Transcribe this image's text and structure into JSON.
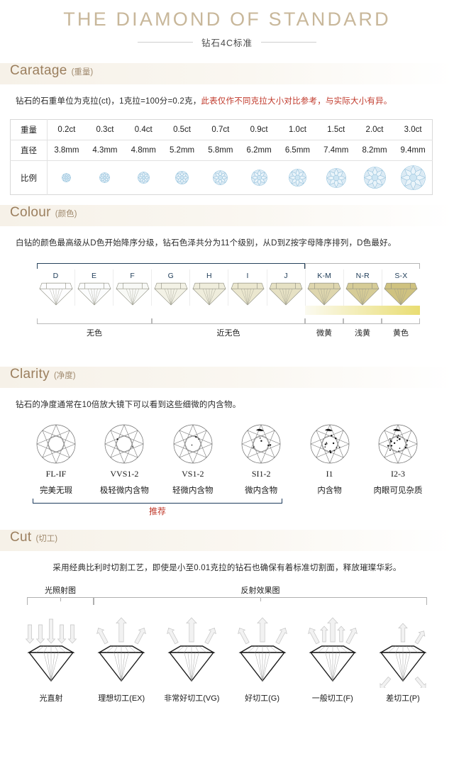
{
  "masthead": {
    "title": "THE DIAMOND OF STANDARD",
    "subtitle": "钻石4C标准"
  },
  "sections": {
    "caratage": {
      "en": "Caratage",
      "cn": "(重量)",
      "desc_black": "钻石的石重单位为克拉(ct)，1克拉=100分=0.2克，",
      "desc_red": "此表仅作不同克拉大小对比参考，与实际大小有异。",
      "table": {
        "row_labels": [
          "重量",
          "直径",
          "比例"
        ],
        "weights": [
          "0.2ct",
          "0.3ct",
          "0.4ct",
          "0.5ct",
          "0.7ct",
          "0.9ct",
          "1.0ct",
          "1.5ct",
          "2.0ct",
          "3.0ct"
        ],
        "diameters": [
          "3.8mm",
          "4.3mm",
          "4.8mm",
          "5.2mm",
          "5.8mm",
          "6.2mm",
          "6.5mm",
          "7.4mm",
          "8.2mm",
          "9.4mm"
        ],
        "gem_sizes": [
          13,
          15,
          17,
          19,
          21,
          23,
          25,
          28,
          31,
          35
        ]
      }
    },
    "colour": {
      "en": "Colour",
      "cn": "(颜色)",
      "desc": "白钻的颜色最高级从D色开始降序分级，钻石色泽共分为11个级别，从D到Z按字母降序排列，D色最好。",
      "grades": [
        {
          "label": "D",
          "tint": "#fdfdff"
        },
        {
          "label": "E",
          "tint": "#fbfcfd"
        },
        {
          "label": "F",
          "tint": "#f8f9f6"
        },
        {
          "label": "G",
          "tint": "#f3f2e6"
        },
        {
          "label": "H",
          "tint": "#efeddc"
        },
        {
          "label": "I",
          "tint": "#ebe7cf"
        },
        {
          "label": "J",
          "tint": "#e6e1c4"
        },
        {
          "label": "K-M",
          "tint": "#ded6ae"
        },
        {
          "label": "N-R",
          "tint": "#d6cc97"
        },
        {
          "label": "S-X",
          "tint": "#cfc280"
        }
      ],
      "top_brackets": [
        {
          "name": "colorless-to-near-colorless",
          "style": "navy",
          "start": 0,
          "span": 7
        },
        {
          "name": "tinted",
          "style": "grey",
          "start": 7,
          "span": 3
        }
      ],
      "bottom_groups": [
        {
          "label": "无色",
          "start": 0,
          "span": 3
        },
        {
          "label": "近无色",
          "start": 3,
          "span": 4
        },
        {
          "label": "微黄",
          "start": 7,
          "span": 1
        },
        {
          "label": "浅黄",
          "start": 8,
          "span": 1
        },
        {
          "label": "黄色",
          "start": 9,
          "span": 1
        }
      ],
      "yellow_bar": {
        "start_grade": "K-M",
        "from": "#fbfaf0",
        "to": "#e9dd72"
      }
    },
    "clarity": {
      "en": "Clarity",
      "cn": "(净度)",
      "desc": "钻石的净度通常在10倍放大镜下可以看到这些细微的内含物。",
      "grades": [
        {
          "code": "FL-IF",
          "cn": "完美无瑕",
          "inclusions": 0
        },
        {
          "code": "VVS1-2",
          "cn": "极轻微内含物",
          "inclusions": 2
        },
        {
          "code": "VS1-2",
          "cn": "轻微内含物",
          "inclusions": 3
        },
        {
          "code": "SI1-2",
          "cn": "微内含物",
          "inclusions": 6
        },
        {
          "code": "I1",
          "cn": "内含物",
          "inclusions": 12
        },
        {
          "code": "I2-3",
          "cn": "肉眼可见杂质",
          "inclusions": 18
        }
      ],
      "recommend_label": "推荐",
      "recommend_color": "#c0392b",
      "recommend_span": [
        "FL-IF",
        "SI1-2"
      ]
    },
    "cut": {
      "en": "Cut",
      "cn": "(切工)",
      "desc": "采用经典比利时切割工艺，即使是小至0.01克拉的钻石也确保有着标准切割面，释放璀璨华彩。",
      "group_labels": [
        {
          "label": "光照射图",
          "start": 0,
          "span": 1
        },
        {
          "label": "反射效果图",
          "start": 1,
          "span": 5
        }
      ],
      "items": [
        {
          "label": "光直射",
          "mode": "incoming",
          "up_arrows": 0,
          "leak": false
        },
        {
          "label": "理想切工(EX)",
          "mode": "reflect",
          "up_arrows": 3,
          "leak": false
        },
        {
          "label": "非常好切工(VG)",
          "mode": "reflect",
          "up_arrows": 3,
          "leak": false
        },
        {
          "label": "好切工(G)",
          "mode": "reflect",
          "up_arrows": 3,
          "leak": false
        },
        {
          "label": "一般切工(F)",
          "mode": "reflect",
          "up_arrows": 4,
          "leak": false
        },
        {
          "label": "差切工(P)",
          "mode": "reflect",
          "up_arrows": 2,
          "leak": true
        }
      ]
    }
  },
  "palette": {
    "gold": "#c8b79a",
    "header_text": "#9b7f5e",
    "navy": "#26425c",
    "red": "#c0392b",
    "gem_blue": "#bcd9ea"
  }
}
